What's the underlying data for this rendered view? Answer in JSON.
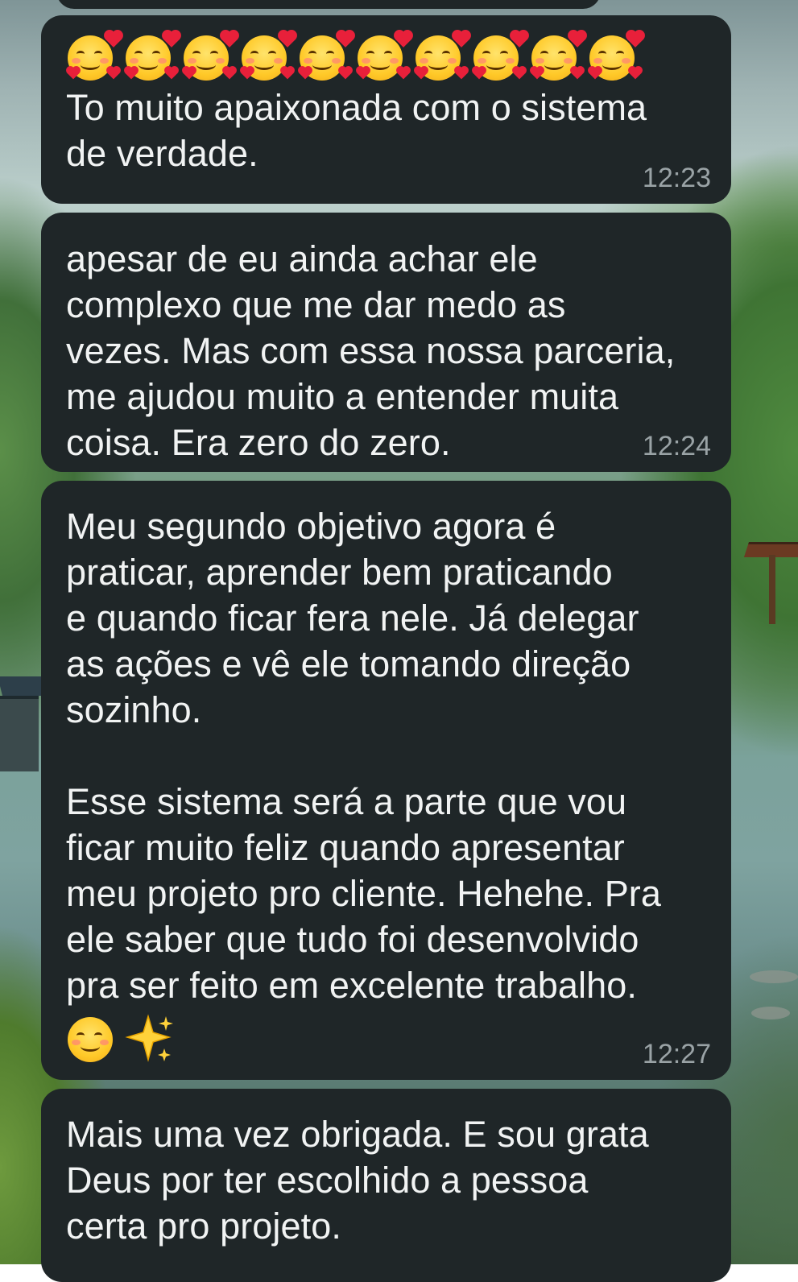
{
  "messages": [
    {
      "emojis_prefix": "🥰🥰🥰🥰🥰🥰🥰🥰🥰🥰",
      "text": "To muito apaixonada com o sistema\nde verdade.",
      "time": "12:23"
    },
    {
      "text": "apesar de eu ainda achar ele\ncomplexo que me dar medo as\nvezes. Mas com essa nossa parceria,\nme ajudou muito a entender muita\ncoisa. Era zero do zero.",
      "time": "12:24"
    },
    {
      "text": "Meu segundo objetivo agora é\npraticar, aprender bem praticando\ne quando ficar fera nele. Já delegar\nas ações e vê ele tomando direção\nsozinho.\n\nEsse sistema será a parte que vou\nficar muito feliz quando apresentar\nmeu projeto pro cliente. Hehehe. Pra\nele saber que tudo foi desenvolvido\npra ser feito em excelente trabalho.",
      "emojis_suffix": "☺️✨",
      "time": "12:27"
    },
    {
      "text": "Mais uma vez obrigada. E sou grata\nDeus por ter escolhido a pessoa\ncerta pro projeto."
    }
  ],
  "icons": {
    "smiling_face_with_hearts": "smiling-face-with-hearts-icon",
    "smiling_face": "smiling-face-icon",
    "sparkles": "sparkles-icon"
  },
  "colors": {
    "bubble_background": "#1f2628",
    "message_text": "#f1f3f3",
    "timestamp_text": "#9aa3a6"
  }
}
